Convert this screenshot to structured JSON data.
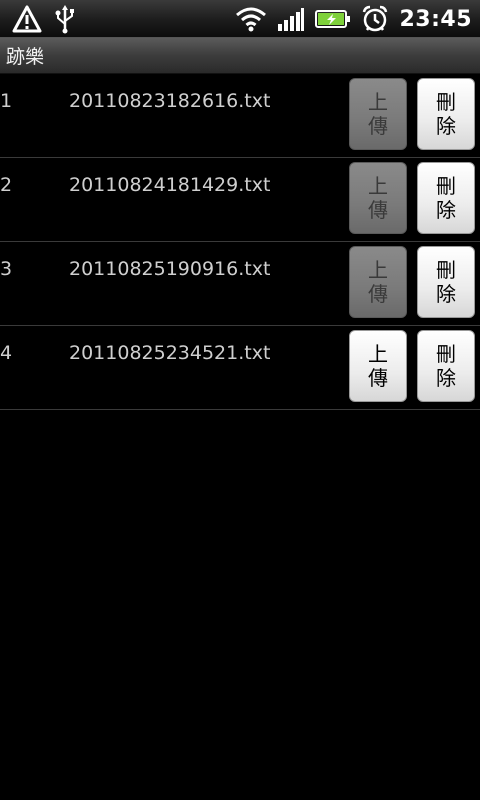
{
  "status_bar": {
    "time": "23:45",
    "icons": [
      "warning-icon",
      "usb-icon",
      "wifi-icon",
      "signal-icon",
      "battery-charging-icon",
      "alarm-icon"
    ],
    "battery_color": "#7fd13b"
  },
  "title": "跡樂",
  "rows": [
    {
      "num": "1",
      "file": "20110823182616.txt",
      "upload_line1": "上",
      "upload_line2": "傳",
      "upload_enabled": false,
      "delete_line1": "刪",
      "delete_line2": "除"
    },
    {
      "num": "2",
      "file": "20110824181429.txt",
      "upload_line1": "上",
      "upload_line2": "傳",
      "upload_enabled": false,
      "delete_line1": "刪",
      "delete_line2": "除"
    },
    {
      "num": "3",
      "file": "20110825190916.txt",
      "upload_line1": "上",
      "upload_line2": "傳",
      "upload_enabled": false,
      "delete_line1": "刪",
      "delete_line2": "除"
    },
    {
      "num": "4",
      "file": "20110825234521.txt",
      "upload_line1": "上",
      "upload_line2": "傳",
      "upload_enabled": true,
      "delete_line1": "刪",
      "delete_line2": "除"
    }
  ]
}
